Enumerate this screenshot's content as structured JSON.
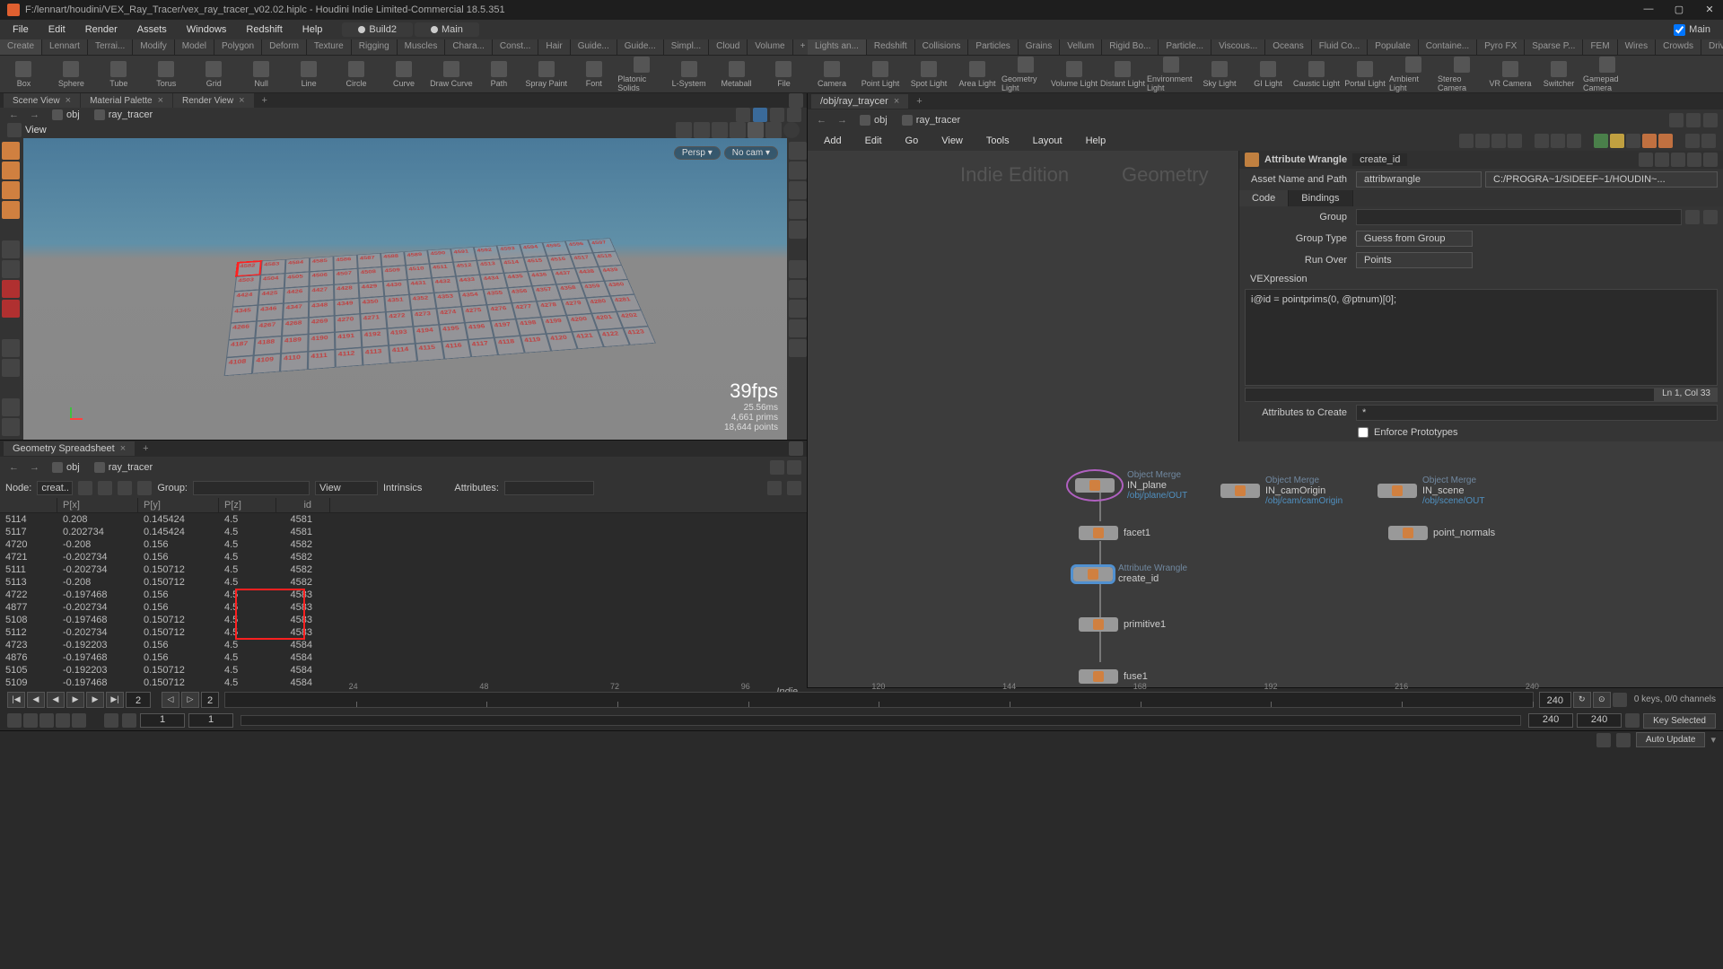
{
  "title": "F:/lennart/houdini/VEX_Ray_Tracer/vex_ray_tracer_v02.02.hiplc - Houdini Indie Limited-Commercial 18.5.351",
  "menubar": [
    "File",
    "Edit",
    "Render",
    "Assets",
    "Windows",
    "Redshift",
    "Help"
  ],
  "build_tabs": [
    "Build2",
    "Main"
  ],
  "main_checkbox": "Main",
  "shelf_left": [
    "Create",
    "Lennart",
    "Terrai...",
    "Modify",
    "Model",
    "Polygon",
    "Deform",
    "Texture",
    "Rigging",
    "Muscles",
    "Chara...",
    "Const...",
    "Hair",
    "Guide...",
    "Guide...",
    "Simpl...",
    "Cloud",
    "Volume",
    "+"
  ],
  "shelf_right": [
    "Lights an...",
    "Redshift",
    "Collisions",
    "Particles",
    "Grains",
    "Vellum",
    "Rigid Bo...",
    "Particle...",
    "Viscous...",
    "Oceans",
    "Fluid Co...",
    "Populate",
    "Containe...",
    "Pyro FX",
    "Sparse P...",
    "FEM",
    "Wires",
    "Crowds",
    "Drive Si..."
  ],
  "tools_left": [
    "Box",
    "Sphere",
    "Tube",
    "Torus",
    "Grid",
    "Null",
    "Line",
    "Circle",
    "Curve",
    "Draw Curve",
    "Path",
    "Spray Paint",
    "Font",
    "Platonic Solids",
    "L-System",
    "Metaball",
    "File"
  ],
  "tools_right": [
    "Camera",
    "Point Light",
    "Spot Light",
    "Area Light",
    "Geometry Light",
    "Volume Light",
    "Distant Light",
    "Environment Light",
    "Sky Light",
    "GI Light",
    "Caustic Light",
    "Portal Light",
    "Ambient Light",
    "Stereo Camera",
    "VR Camera",
    "Switcher",
    "Gamepad Camera"
  ],
  "scene_tabs": [
    "Scene View",
    "Material Palette",
    "Render View"
  ],
  "view_label": "View",
  "path": {
    "obj": "obj",
    "node": "ray_tracer"
  },
  "badges": {
    "persp": "Persp ▾",
    "cam": "No cam ▾"
  },
  "fps": {
    "main": "39fps",
    "ms": "25.56ms",
    "prims": "4,661 prims",
    "points": "18,644 points"
  },
  "highlighted_cell": "4582",
  "grid_start_ids": [
    4582,
    4503,
    4424,
    4345,
    4266,
    4187,
    4108
  ],
  "ss_tabs": [
    "Geometry Spreadsheet"
  ],
  "ss_filter": {
    "node": "Node:",
    "node_val": "creat...",
    "group": "Group:",
    "view": "View",
    "intrinsics": "Intrinsics",
    "attrs": "Attributes:"
  },
  "ss_cols": [
    "",
    "P[x]",
    "P[y]",
    "P[z]",
    "id"
  ],
  "ss_rows": [
    {
      "n": "5114",
      "px": "0.208",
      "py": "0.145424",
      "pz": "4.5",
      "id": "4581"
    },
    {
      "n": "5117",
      "px": "0.202734",
      "py": "0.145424",
      "pz": "4.5",
      "id": "4581"
    },
    {
      "n": "4720",
      "px": "-0.208",
      "py": "0.156",
      "pz": "4.5",
      "id": "4582"
    },
    {
      "n": "4721",
      "px": "-0.202734",
      "py": "0.156",
      "pz": "4.5",
      "id": "4582"
    },
    {
      "n": "5111",
      "px": "-0.202734",
      "py": "0.150712",
      "pz": "4.5",
      "id": "4582"
    },
    {
      "n": "5113",
      "px": "-0.208",
      "py": "0.150712",
      "pz": "4.5",
      "id": "4582"
    },
    {
      "n": "4722",
      "px": "-0.197468",
      "py": "0.156",
      "pz": "4.5",
      "id": "4583"
    },
    {
      "n": "4877",
      "px": "-0.202734",
      "py": "0.156",
      "pz": "4.5",
      "id": "4583"
    },
    {
      "n": "5108",
      "px": "-0.197468",
      "py": "0.150712",
      "pz": "4.5",
      "id": "4583"
    },
    {
      "n": "5112",
      "px": "-0.202734",
      "py": "0.150712",
      "pz": "4.5",
      "id": "4583"
    },
    {
      "n": "4723",
      "px": "-0.192203",
      "py": "0.156",
      "pz": "4.5",
      "id": "4584"
    },
    {
      "n": "4876",
      "px": "-0.197468",
      "py": "0.156",
      "pz": "4.5",
      "id": "4584"
    },
    {
      "n": "5105",
      "px": "-0.192203",
      "py": "0.150712",
      "pz": "4.5",
      "id": "4584"
    },
    {
      "n": "5109",
      "px": "-0.197468",
      "py": "0.150712",
      "pz": "4.5",
      "id": "4584"
    }
  ],
  "ss_footer": "Indie",
  "net_tabs": [
    "/obj/ray_traycer"
  ],
  "net_menu": [
    "Add",
    "Edit",
    "Go",
    "View",
    "Tools",
    "Layout",
    "Help"
  ],
  "watermark1": "Indie Edition",
  "watermark2": "Geometry",
  "param": {
    "node_type": "Attribute Wrangle",
    "node_name": "create_id",
    "asset_label": "Asset Name and Path",
    "asset_val": "attribwrangle",
    "asset_path": "C:/PROGRA~1/SIDEEF~1/HOUDIN~...",
    "tabs": [
      "Code",
      "Bindings"
    ],
    "group_label": "Group",
    "grouptype_label": "Group Type",
    "grouptype_val": "Guess from Group",
    "runover_label": "Run Over",
    "runover_val": "Points",
    "vex_label": "VEXpression",
    "code": "i@id = pointprims(0, @ptnum)[0];",
    "code_pos": "Ln 1, Col 33",
    "attrs_label": "Attributes to Create",
    "attrs_val": "*",
    "enforce": "Enforce Prototypes"
  },
  "nodes": {
    "n1": {
      "type": "Object Merge",
      "name": "IN_plane",
      "path": "/obj/plane/OUT"
    },
    "n2": {
      "type": "Object Merge",
      "name": "IN_camOrigin",
      "path": "/obj/cam/camOrigin"
    },
    "n3": {
      "type": "Object Merge",
      "name": "IN_scene",
      "path": "/obj/scene/OUT"
    },
    "n4": {
      "name": "facet1"
    },
    "n5": {
      "name": "point_normals"
    },
    "n6": {
      "type": "Attribute Wrangle",
      "name": "create_id"
    },
    "n7": {
      "name": "primitive1"
    },
    "n8": {
      "name": "fuse1"
    }
  },
  "timeline": {
    "frame": "2",
    "ticks": [
      "24",
      "48",
      "72",
      "96",
      "120",
      "144",
      "168",
      "192",
      "216",
      "240"
    ],
    "end": "240",
    "keys": "0 keys, 0/0 channels",
    "range_start": "1",
    "range_start2": "1",
    "range_end": "240",
    "range_end2": "240",
    "key_sel": "Key Selected"
  },
  "status": {
    "auto": "Auto Update"
  }
}
